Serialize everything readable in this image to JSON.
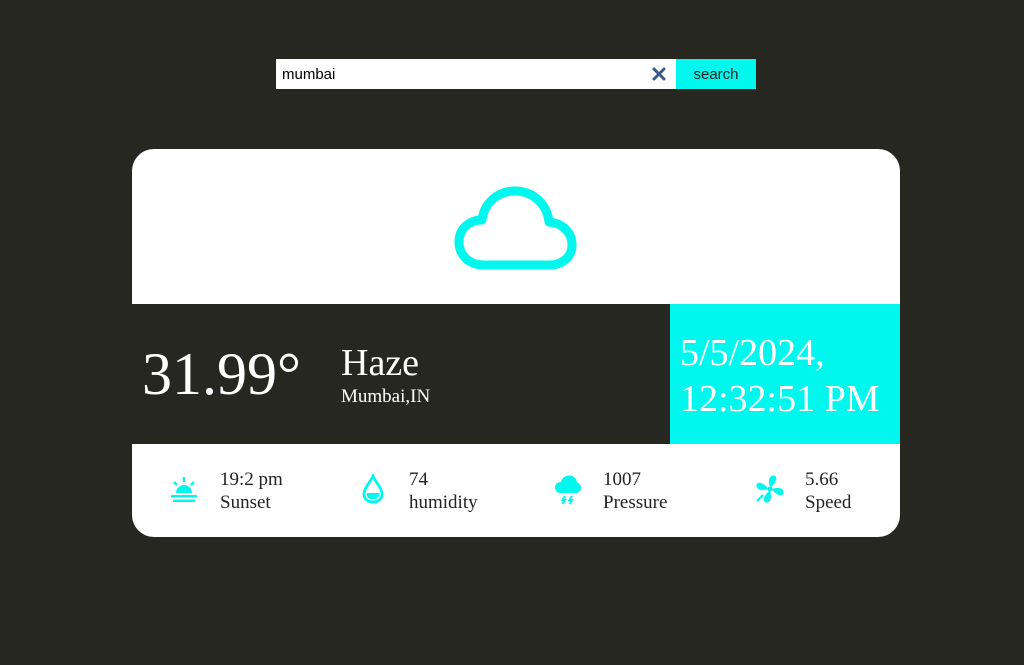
{
  "search": {
    "value": "mumbai",
    "button_label": "search"
  },
  "weather": {
    "temperature": "31.99°",
    "condition": "Haze",
    "location": "Mumbai,IN",
    "date": "5/5/2024,",
    "time": "12:32:51 PM",
    "icon": "cloud-icon"
  },
  "stats": [
    {
      "icon": "sunset-icon",
      "value": "19:2 pm",
      "label": "Sunset"
    },
    {
      "icon": "humidity-drop-icon",
      "value": "74",
      "label": "humidity"
    },
    {
      "icon": "rain-cloud-icon",
      "value": "1007",
      "label": "Pressure"
    },
    {
      "icon": "wind-fan-icon",
      "value": "5.66",
      "label": "Speed"
    }
  ],
  "colors": {
    "background": "#272722",
    "accent": "#00f7ed",
    "card": "#ffffff",
    "clear_icon": "#3a5a8c"
  }
}
